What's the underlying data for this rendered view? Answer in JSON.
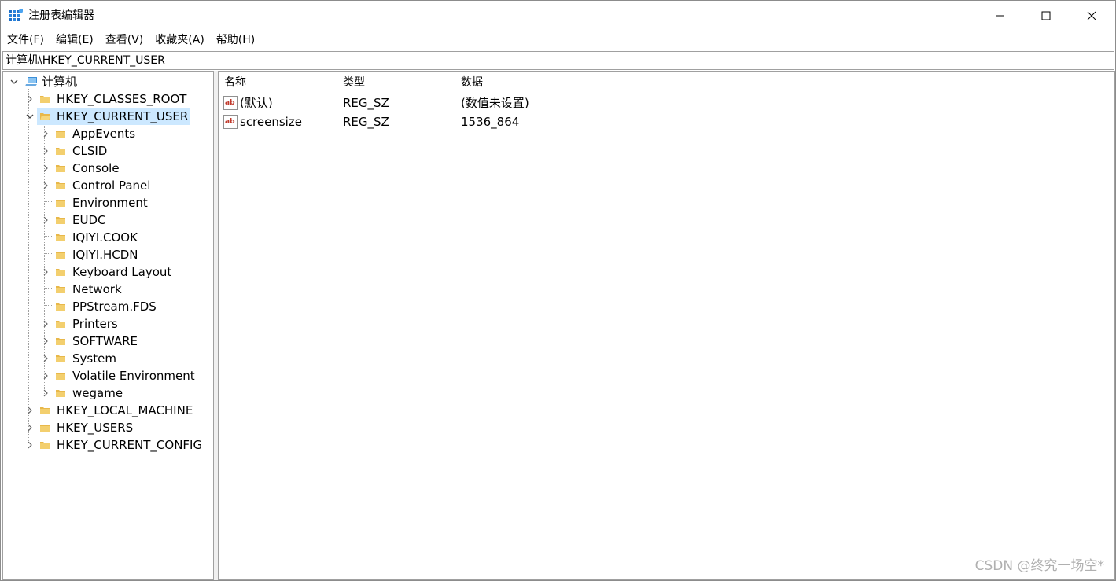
{
  "window": {
    "title": "注册表编辑器",
    "icon": "registry-editor-icon"
  },
  "menu": [
    "文件(F)",
    "编辑(E)",
    "查看(V)",
    "收藏夹(A)",
    "帮助(H)"
  ],
  "address": "计算机\\HKEY_CURRENT_USER",
  "tree": {
    "root": "计算机",
    "hives": {
      "classes_root": "HKEY_CLASSES_ROOT",
      "current_user": "HKEY_CURRENT_USER",
      "local_machine": "HKEY_LOCAL_MACHINE",
      "users": "HKEY_USERS",
      "current_config": "HKEY_CURRENT_CONFIG"
    },
    "current_user_children": [
      {
        "label": "AppEvents",
        "expandable": true
      },
      {
        "label": "CLSID",
        "expandable": true
      },
      {
        "label": "Console",
        "expandable": true
      },
      {
        "label": "Control Panel",
        "expandable": true
      },
      {
        "label": "Environment",
        "expandable": false
      },
      {
        "label": "EUDC",
        "expandable": true
      },
      {
        "label": "IQIYI.COOK",
        "expandable": false
      },
      {
        "label": "IQIYI.HCDN",
        "expandable": false
      },
      {
        "label": "Keyboard Layout",
        "expandable": true
      },
      {
        "label": "Network",
        "expandable": false
      },
      {
        "label": "PPStream.FDS",
        "expandable": false
      },
      {
        "label": "Printers",
        "expandable": true
      },
      {
        "label": "SOFTWARE",
        "expandable": true
      },
      {
        "label": "System",
        "expandable": true
      },
      {
        "label": "Volatile Environment",
        "expandable": true
      },
      {
        "label": "wegame",
        "expandable": true
      }
    ]
  },
  "list": {
    "columns": [
      "名称",
      "类型",
      "数据"
    ],
    "rows": [
      {
        "name": "(默认)",
        "type": "REG_SZ",
        "data": "(数值未设置)",
        "icon": "string-value-icon"
      },
      {
        "name": "screensize",
        "type": "REG_SZ",
        "data": "1536_864",
        "icon": "string-value-icon"
      }
    ]
  },
  "watermark": "CSDN @终究一场空*",
  "colors": {
    "selection": "#cce8ff",
    "folder": "#e8b84a",
    "border": "#a0a0a0"
  }
}
